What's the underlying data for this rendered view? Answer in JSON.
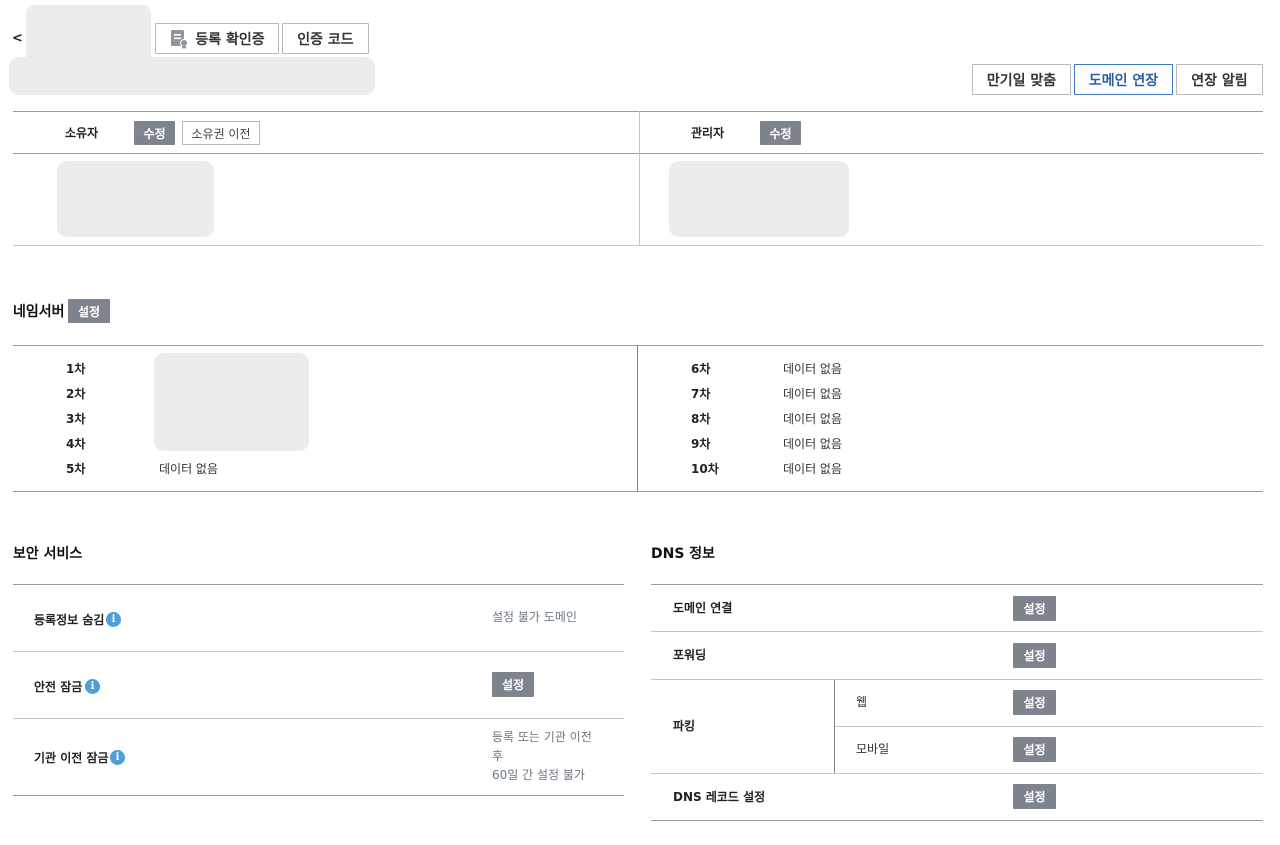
{
  "header": {
    "back": "<",
    "btn_reg_cert": "등록 확인증",
    "btn_auth_code": "인증 코드",
    "btn_align_expiry": "만기일 맞춤",
    "btn_domain_renew": "도메인 연장",
    "btn_renew_alert": "연장 알림"
  },
  "contacts": {
    "owner_label": "소유자",
    "owner_edit": "수정",
    "owner_transfer": "소유권 이전",
    "admin_label": "관리자",
    "admin_edit": "수정"
  },
  "nameserver": {
    "title": "네임서버",
    "set": "설정",
    "left": [
      {
        "rank": "1차",
        "value": ""
      },
      {
        "rank": "2차",
        "value": ""
      },
      {
        "rank": "3차",
        "value": ""
      },
      {
        "rank": "4차",
        "value": ""
      },
      {
        "rank": "5차",
        "value": "데이터 없음"
      }
    ],
    "right": [
      {
        "rank": "6차",
        "value": "데이터 없음"
      },
      {
        "rank": "7차",
        "value": "데이터 없음"
      },
      {
        "rank": "8차",
        "value": "데이터 없음"
      },
      {
        "rank": "9차",
        "value": "데이터 없음"
      },
      {
        "rank": "10차",
        "value": "데이터 없음"
      }
    ]
  },
  "security": {
    "title": "보안 서비스",
    "privacy_label": "등록정보 숨김",
    "privacy_value": "설정 불가 도메인",
    "lock_label": "안전 잠금",
    "lock_btn": "설정",
    "transfer_lock_label": "기관 이전 잠금",
    "transfer_lock_value_1": "등록 또는 기관 이전",
    "transfer_lock_value_2": "후",
    "transfer_lock_value_3": "60일 간 설정 불가",
    "info_glyph": "i"
  },
  "dns": {
    "title": "DNS 정보",
    "domain_connect": "도메인 연결",
    "forwarding": "포워딩",
    "parking": "파킹",
    "web": "웹",
    "mobile": "모바일",
    "dns_record": "DNS 레코드 설정",
    "set": "설정"
  }
}
